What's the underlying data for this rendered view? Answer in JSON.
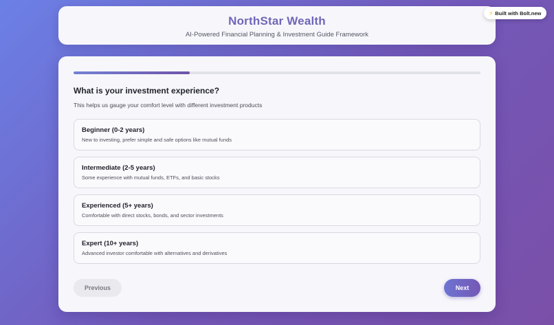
{
  "header": {
    "title": "NorthStar Wealth",
    "subtitle": "AI-Powered Financial Planning & Investment Guide Framework"
  },
  "badge": {
    "icon": "lightning-icon",
    "label": "Built with Bolt.new"
  },
  "progress": {
    "fraction": 0.285
  },
  "question": {
    "title": "What is your investment experience?",
    "help": "This helps us gauge your comfort level with different investment products",
    "options": [
      {
        "label": "Beginner (0-2 years)",
        "description": "New to investing, prefer simple and safe options like mutual funds"
      },
      {
        "label": "Intermediate (2-5 years)",
        "description": "Some experience with mutual funds, ETFs, and basic stocks"
      },
      {
        "label": "Experienced (5+ years)",
        "description": "Comfortable with direct stocks, bonds, and sector investments"
      },
      {
        "label": "Expert (10+ years)",
        "description": "Advanced investor comfortable with alternatives and derivatives"
      }
    ]
  },
  "nav": {
    "previous_label": "Previous",
    "next_label": "Next"
  },
  "colors": {
    "brand": "#6f66b8",
    "accent": "#7558b6",
    "background_start": "#6b80e6",
    "background_end": "#7a4fa8"
  }
}
